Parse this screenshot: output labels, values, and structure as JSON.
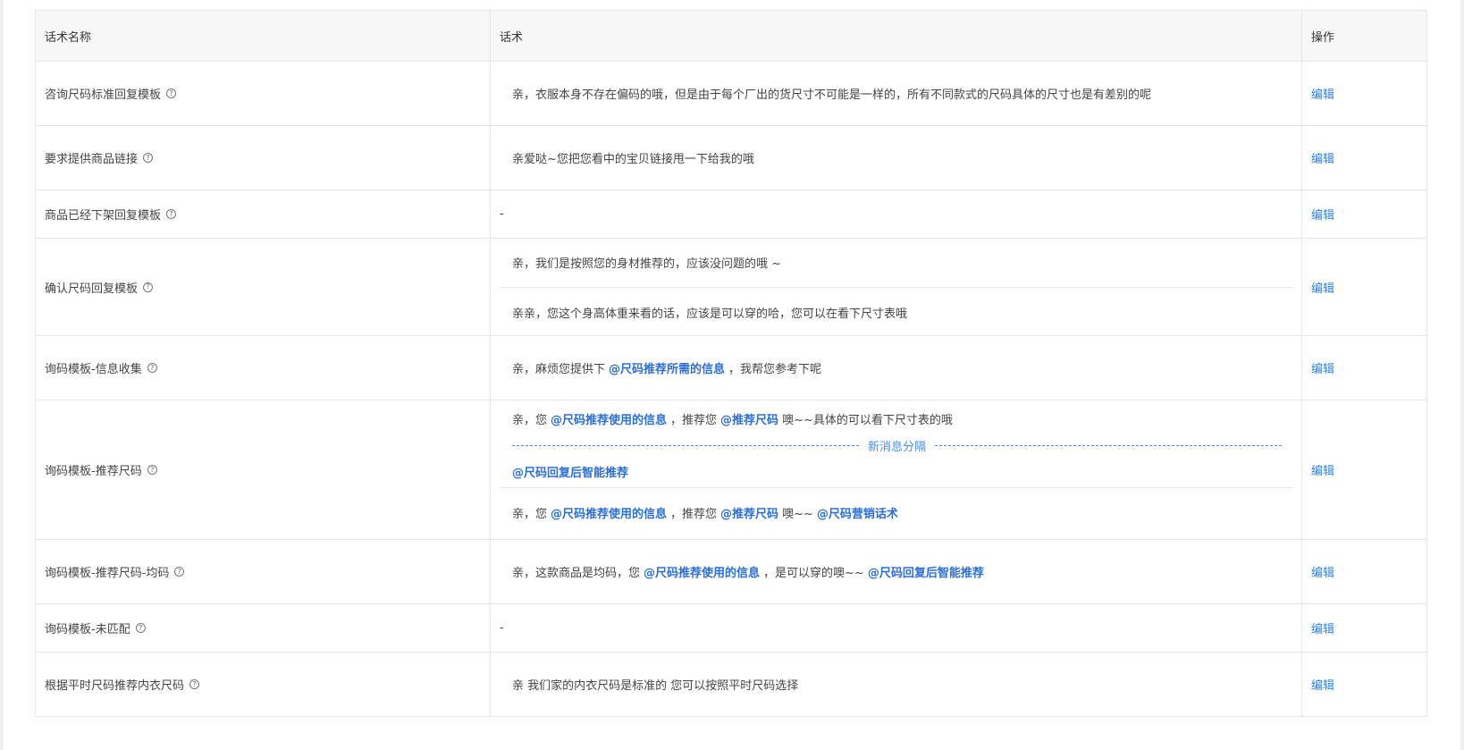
{
  "table": {
    "headers": {
      "name": "话术名称",
      "script": "话术",
      "action": "操作"
    },
    "rows": [
      {
        "name": "咨询尺码标准回复模板",
        "help_icon": "?",
        "action": "编辑",
        "lines": [
          {
            "parts": [
              {
                "t": "text",
                "v": "亲，衣服本身不存在偏码的哦，但是由于每个厂出的货尺寸不可能是一样的，所有不同款式的尺码具体的尺寸也是有差别的呢"
              }
            ]
          }
        ]
      },
      {
        "name": "要求提供商品链接",
        "help_icon": "?",
        "action": "编辑",
        "lines": [
          {
            "parts": [
              {
                "t": "text",
                "v": "亲爱哒~您把您看中的宝贝链接甩一下给我的哦"
              }
            ]
          }
        ]
      },
      {
        "name": "商品已经下架回复模板",
        "help_icon": "?",
        "action": "编辑",
        "dash": "-"
      },
      {
        "name": "确认尺码回复模板",
        "help_icon": "?",
        "action": "编辑",
        "lines": [
          {
            "parts": [
              {
                "t": "text",
                "v": "亲，我们是按照您的身材推荐的，应该没问题的哦 ~"
              }
            ]
          },
          {
            "parts": [
              {
                "t": "text",
                "v": "亲亲，您这个身高体重来看的话，应该是可以穿的哈，您可以在看下尺寸表哦"
              }
            ]
          }
        ]
      },
      {
        "name": "询码模板-信息收集",
        "help_icon": "?",
        "action": "编辑",
        "lines": [
          {
            "parts": [
              {
                "t": "text",
                "v": "亲，麻烦您提供下"
              },
              {
                "t": "var",
                "v": "@尺码推荐所需的信息"
              },
              {
                "t": "text",
                "v": "，我帮您参考下呢"
              }
            ]
          }
        ]
      },
      {
        "name": "询码模板-推荐尺码",
        "help_icon": "?",
        "action": "编辑",
        "lines": [
          {
            "parts": [
              {
                "t": "text",
                "v": "亲，您"
              },
              {
                "t": "var",
                "v": "@尺码推荐使用的信息"
              },
              {
                "t": "text",
                "v": "，推荐您"
              },
              {
                "t": "var",
                "v": "@推荐尺码"
              },
              {
                "t": "text",
                "v": "噢~~具体的可以看下尺寸表的哦"
              }
            ]
          },
          {
            "divider": "新消息分隔"
          },
          {
            "parts": [
              {
                "t": "var0",
                "v": "@尺码回复后智能推荐"
              }
            ]
          },
          {
            "parts": [
              {
                "t": "text",
                "v": "亲，您"
              },
              {
                "t": "var",
                "v": "@尺码推荐使用的信息"
              },
              {
                "t": "text",
                "v": "，推荐您"
              },
              {
                "t": "var",
                "v": "@推荐尺码"
              },
              {
                "t": "text",
                "v": "噢~~"
              },
              {
                "t": "var",
                "v": "@尺码营销话术"
              }
            ]
          }
        ]
      },
      {
        "name": "询码模板-推荐尺码-均码",
        "help_icon": "?",
        "action": "编辑",
        "lines": [
          {
            "parts": [
              {
                "t": "text",
                "v": "亲，这款商品是均码，您"
              },
              {
                "t": "var",
                "v": "@尺码推荐使用的信息"
              },
              {
                "t": "text",
                "v": "，是可以穿的噢~~"
              },
              {
                "t": "var",
                "v": "@尺码回复后智能推荐"
              }
            ]
          }
        ]
      },
      {
        "name": "询码模板-未匹配",
        "help_icon": "?",
        "action": "编辑",
        "dash": "-"
      },
      {
        "name": "根据平时尺码推荐内衣尺码",
        "help_icon": "?",
        "action": "编辑",
        "lines": [
          {
            "parts": [
              {
                "t": "text",
                "v": "亲 我们家的内衣尺码是标准的 您可以按照平时尺码选择"
              }
            ]
          }
        ]
      }
    ]
  },
  "colors": {
    "link": "#2b82e8",
    "variable": "#2b6fd6",
    "border": "#e6e6e6",
    "header_bg": "#f7f7f7"
  }
}
